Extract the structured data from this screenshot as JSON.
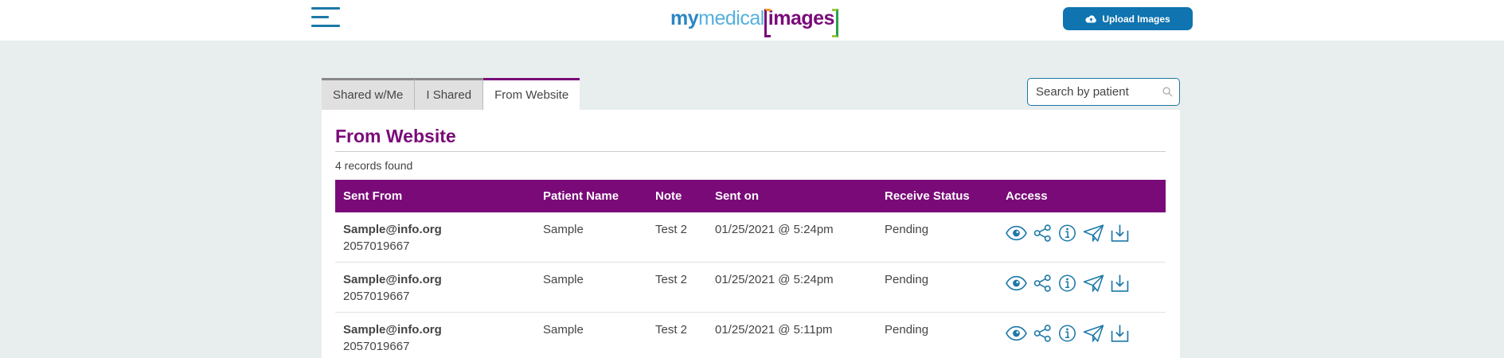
{
  "header": {
    "logo": {
      "my": "my",
      "medical": "medical",
      "images": "images"
    },
    "upload_button": "Upload Images"
  },
  "tabs": [
    {
      "label": "Shared w/Me",
      "active": false
    },
    {
      "label": "I Shared",
      "active": false
    },
    {
      "label": "From Website",
      "active": true
    }
  ],
  "search": {
    "placeholder": "Search by patient"
  },
  "panel": {
    "title": "From Website",
    "record_count": "4 records found"
  },
  "table": {
    "columns": [
      "Sent From",
      "Patient Name",
      "Note",
      "Sent on",
      "Receive Status",
      "Access"
    ],
    "rows": [
      {
        "email": "Sample@info.org",
        "phone": "2057019667",
        "patient": "Sample",
        "note": "Test 2",
        "sent_on": "01/25/2021 @ 5:24pm",
        "status": "Pending"
      },
      {
        "email": "Sample@info.org",
        "phone": "2057019667",
        "patient": "Sample",
        "note": "Test 2",
        "sent_on": "01/25/2021 @ 5:24pm",
        "status": "Pending"
      },
      {
        "email": "Sample@info.org",
        "phone": "2057019667",
        "patient": "Sample",
        "note": "Test 2",
        "sent_on": "01/25/2021 @ 5:11pm",
        "status": "Pending"
      }
    ],
    "access_icons": [
      "eye-icon",
      "share-icon",
      "info-icon",
      "send-icon",
      "download-icon"
    ]
  },
  "colors": {
    "brand_purple": "#7a0a78",
    "brand_blue": "#0f74b0",
    "icon_blue": "#1c78a8",
    "page_bg": "#e8eeee"
  }
}
